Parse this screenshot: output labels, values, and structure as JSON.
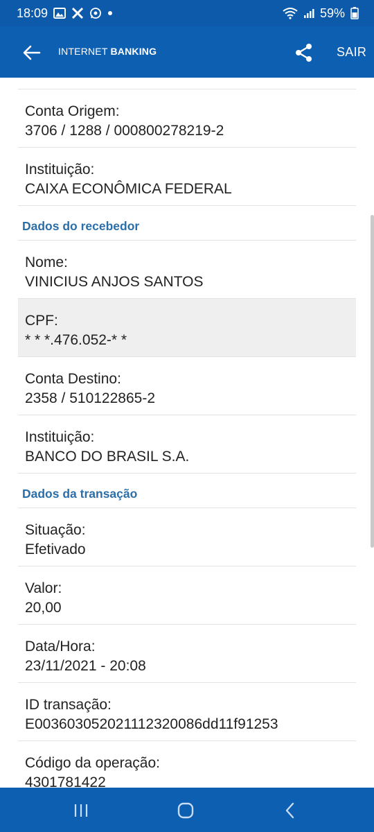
{
  "status_bar": {
    "time": "18:09",
    "battery": "59%",
    "icons": [
      "gallery-icon",
      "x-icon",
      "whatsapp-icon",
      "dot-icon",
      "wifi-icon",
      "signal-icon",
      "battery-icon"
    ]
  },
  "app_bar": {
    "title_light": "INTERNET",
    "title_bold": "BANKING",
    "sair_label": "SAIR"
  },
  "origin": {
    "conta_label": "Conta Origem:",
    "conta_value": "3706 / 1288 / 000800278219-2",
    "instituicao_label": "Instituição:",
    "instituicao_value": "CAIXA ECONÔMICA FEDERAL"
  },
  "receiver": {
    "section_title": "Dados do recebedor",
    "nome_label": "Nome:",
    "nome_value": "VINICIUS ANJOS SANTOS",
    "cpf_label": "CPF:",
    "cpf_value": "* * *.476.052-* *",
    "conta_label": "Conta Destino:",
    "conta_value": "2358 / 510122865-2",
    "instituicao_label": "Instituição:",
    "instituicao_value": "BANCO DO BRASIL S.A."
  },
  "transaction": {
    "section_title": "Dados da transação",
    "situacao_label": "Situação:",
    "situacao_value": "Efetivado",
    "valor_label": "Valor:",
    "valor_value": "20,00",
    "datahora_label": "Data/Hora:",
    "datahora_value": "23/11/2021 - 20:08",
    "id_label": "ID transação:",
    "id_value": "E00360305202111232008​6dd11f91253",
    "codigo_label": "Código da operação:",
    "codigo_value": "4301781422"
  },
  "colors": {
    "status_bar": "#0c5aa9",
    "app_bar": "#0d5fb2",
    "section_title": "#2b6ea8",
    "highlight_row": "#efefef"
  }
}
